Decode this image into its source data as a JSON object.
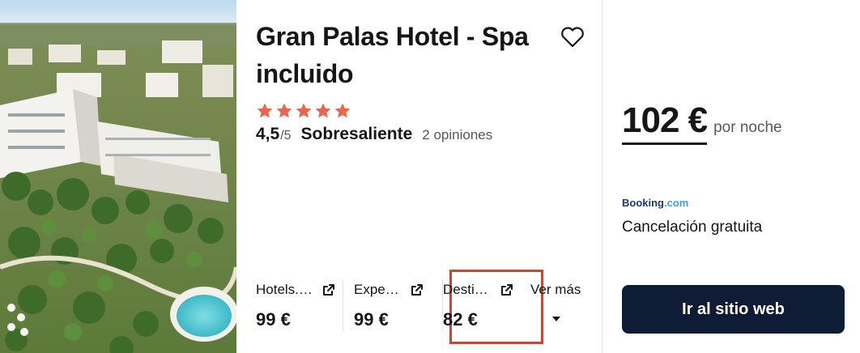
{
  "hotel": {
    "name": "Gran Palas Hotel - Spa incluido",
    "stars": 5,
    "score": "4,5",
    "score_max": "/5",
    "verdict": "Sobresaliente",
    "reviews": "2 opiniones",
    "favorite_icon": "heart-outline-icon",
    "star_color": "#e8674f"
  },
  "providers": [
    {
      "name": "Hotels.…",
      "price": "99 €",
      "icon": "external-link-icon"
    },
    {
      "name": "Expe…",
      "price": "99 €",
      "icon": "external-link-icon"
    },
    {
      "name": "Desti…",
      "price": "82 €",
      "icon": "external-link-icon",
      "highlighted": true
    }
  ],
  "more": {
    "label": "Ver más",
    "icon": "caret-down-icon"
  },
  "offer": {
    "price": "102 €",
    "per_night": "por noche",
    "provider_brand": "Booking",
    "provider_brand_suffix": ".com",
    "cancellation": "Cancelación gratuita",
    "cta_label": "Ir al sitio web"
  },
  "colors": {
    "cta_bg": "#0e1d35",
    "highlight_border": "#d0452f",
    "text_muted": "#545860"
  }
}
